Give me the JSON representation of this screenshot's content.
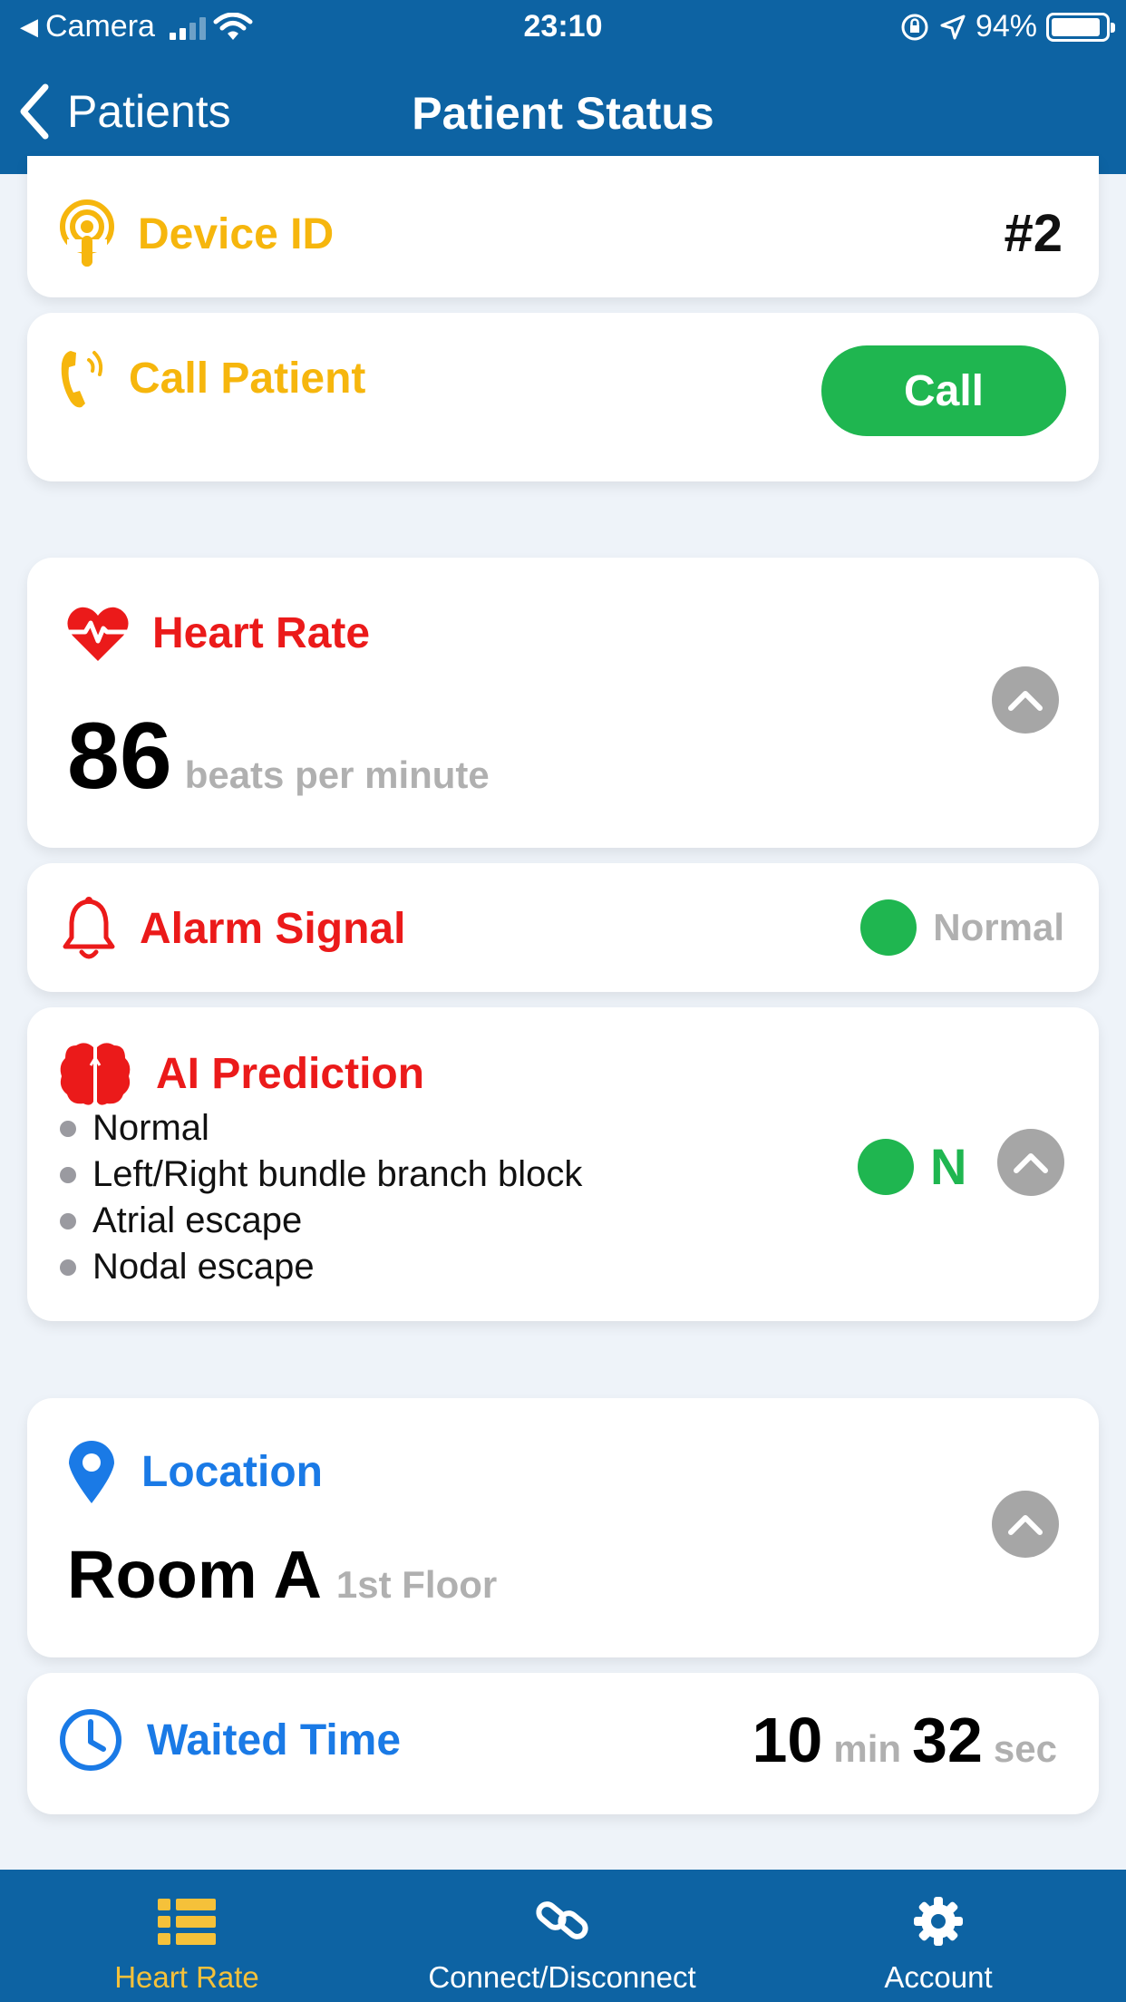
{
  "status_bar": {
    "back_app": "Camera",
    "time": "23:10",
    "battery": "94%"
  },
  "nav": {
    "back_label": "Patients",
    "title": "Patient Status"
  },
  "device": {
    "label": "Device ID",
    "value": "#2"
  },
  "call": {
    "label": "Call Patient",
    "button_label": "Call"
  },
  "heart_rate": {
    "label": "Heart Rate",
    "value": "86",
    "unit": "beats per minute"
  },
  "alarm": {
    "label": "Alarm Signal",
    "status": "Normal",
    "status_color": "#1fb650"
  },
  "ai_prediction": {
    "label": "AI Prediction",
    "classes": [
      "Normal",
      "Left/Right bundle branch block",
      "Atrial escape",
      "Nodal escape"
    ],
    "result": "N",
    "result_color": "#1fb650"
  },
  "location": {
    "label": "Location",
    "room": "Room A",
    "floor": "1st Floor"
  },
  "waited_time": {
    "label": "Waited Time",
    "minutes": "10",
    "min_unit": "min",
    "seconds": "32",
    "sec_unit": "sec"
  },
  "tabs": [
    {
      "label": "Heart Rate",
      "icon": "list-icon",
      "active": true
    },
    {
      "label": "Connect/Disconnect",
      "icon": "link-icon",
      "active": false
    },
    {
      "label": "Account",
      "icon": "gear-icon",
      "active": false
    }
  ],
  "colors": {
    "header": "#0d63a3",
    "accent_yellow": "#f6b60d",
    "accent_red": "#eb1a1a",
    "accent_blue": "#1a7ae6",
    "call_green": "#1fb650"
  }
}
